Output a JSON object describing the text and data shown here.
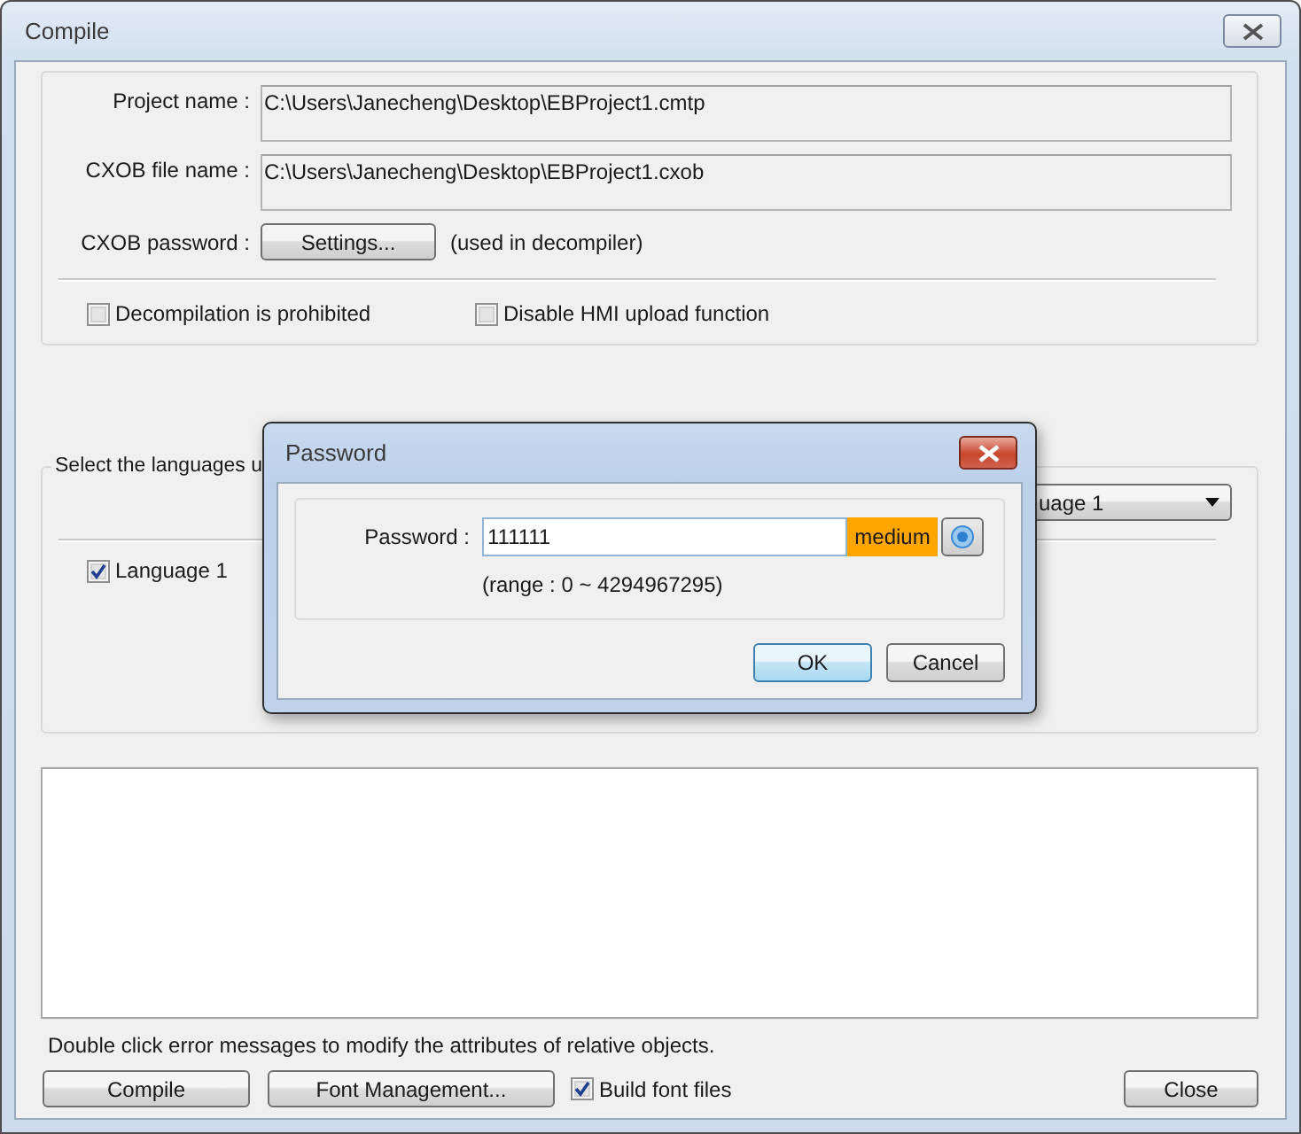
{
  "window": {
    "title": "Compile"
  },
  "fields": [
    {
      "label": "Project name :",
      "value": "C:\\Users\\Janecheng\\Desktop\\EBProject1.cmtp"
    },
    {
      "label": "CXOB file name :",
      "value": "C:\\Users\\Janecheng\\Desktop\\EBProject1.cxob"
    }
  ],
  "cxob_password": {
    "label": "CXOB password :",
    "button": "Settings...",
    "note": "(used in decompiler)"
  },
  "options": [
    {
      "label": "Decompilation is prohibited",
      "checked": false
    },
    {
      "label": "Disable HMI upload function",
      "checked": false
    }
  ],
  "languages": {
    "title": "Select the languages u",
    "dropdown_value": "uage 1",
    "items": [
      {
        "label": "Language 1",
        "checked": true
      }
    ]
  },
  "hint": "Double click error messages to modify the attributes of relative objects.",
  "footer": {
    "compile_button": "Compile",
    "font_button": "Font Management...",
    "build_font_files": {
      "label": "Build font files",
      "checked": true
    },
    "close_button": "Close"
  },
  "password_dialog": {
    "title": "Password",
    "label": "Password :",
    "value": "111111",
    "strength": "medium",
    "range": "(range : 0 ~ 4294967295)",
    "buttons": [
      {
        "label": "OK",
        "default": true
      },
      {
        "label": "Cancel",
        "default": false
      }
    ]
  }
}
